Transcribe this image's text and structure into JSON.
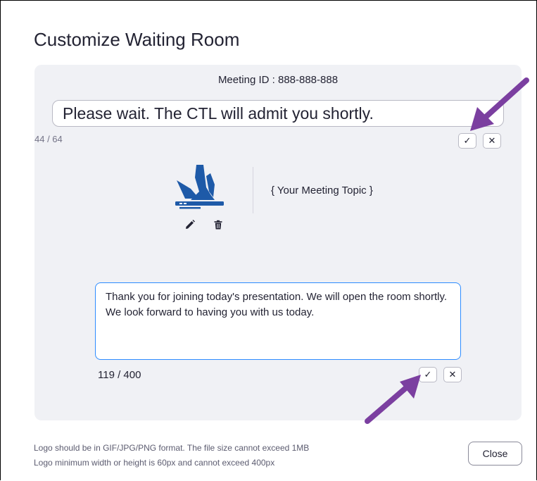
{
  "dialog": {
    "title": "Customize Waiting Room",
    "meeting_id": "Meeting ID : 888-888-888",
    "title_input": {
      "value": "Please wait. The CTL will admit you shortly.",
      "counter": "44 / 64"
    },
    "topic": "{ Your Meeting Topic }",
    "description": {
      "value": "Thank you for joining today's presentation. We will open the room shortly. We look forward to having you with us today.",
      "counter": "119 / 400"
    },
    "confirm_icon": "✓",
    "cancel_icon": "✕",
    "hint_line1": "Logo should be in GIF/JPG/PNG format. The file size cannot exceed 1MB",
    "hint_line2": "Logo minimum width or height is 60px and cannot exceed 400px",
    "close_label": "Close"
  },
  "colors": {
    "logo_blue": "#1e5aa8",
    "accent_blue": "#2d8cff",
    "arrow_purple": "#7b3fa0",
    "panel_bg": "#f0f1f5"
  },
  "icons": {
    "logo": "ctl-logo-icon",
    "edit": "pencil-icon",
    "delete": "trash-icon",
    "confirm": "check-icon",
    "cancel": "close-icon"
  }
}
